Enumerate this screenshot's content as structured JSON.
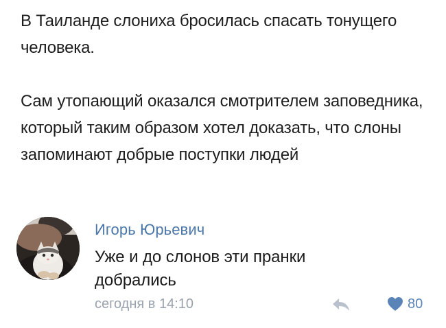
{
  "post": {
    "paragraph_1": "В Таиланде слониха бросилась спасать тонущего человека.",
    "paragraph_2": "Сам утопающий оказался смотрителем заповедника, который таким образом хотел доказать, что слоны запоминают добрые поступки людей"
  },
  "comment": {
    "author": "Игорь Юрьевич",
    "text": "Уже и до слонов эти пранки добрались",
    "timestamp": "сегодня в 14:10",
    "likes": "80",
    "avatar_icon": "cat-avatar",
    "reply_icon": "reply-icon",
    "like_icon": "heart-icon"
  },
  "colors": {
    "author": "#4a76a8",
    "meta": "#9aa3ad",
    "like": "#5a84b8",
    "text": "#1b1b1b"
  }
}
